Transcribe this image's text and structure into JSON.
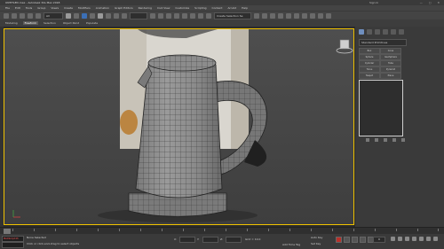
{
  "window": {
    "title": "UNTITLED.max - Autodesk 3ds Max 2018",
    "sign_in": "Sign In",
    "controls": "— ▢ ✕"
  },
  "menu": [
    "File",
    "Edit",
    "Tools",
    "Group",
    "Views",
    "Create",
    "Modifiers",
    "Animation",
    "Graph Editors",
    "Rendering",
    "Civil View",
    "Customize",
    "Scripting",
    "Content",
    "Arnold",
    "Help"
  ],
  "toolbar": {
    "selection_filter": "All",
    "named_selection": "Create Selection Se"
  },
  "ribbon_tabs": [
    {
      "label": "Modeling",
      "active": false
    },
    {
      "label": "Freeform",
      "active": true
    },
    {
      "label": "Selection",
      "active": false
    },
    {
      "label": "Object Paint",
      "active": false
    },
    {
      "label": "Populate",
      "active": false
    }
  ],
  "viewport": {
    "label": "[+] [Perspective] [Standard] [Default Shading]",
    "border_color": "#f0c200"
  },
  "command_panel": {
    "dropdown": "Standard Primitives",
    "buttons": [
      "Box",
      "Cone",
      "Sphere",
      "GeoSphere",
      "Cylinder",
      "Tube",
      "Torus",
      "Pyramid",
      "Teapot",
      "Plane"
    ]
  },
  "timeline": {
    "frame_display": "0 / 100"
  },
  "status": {
    "maxscript": "MAXScript Mi",
    "line1": "None Selected",
    "line2": "Click or click-and-drag to select objects",
    "x_label": "X:",
    "y_label": "Y:",
    "z_label": "Z:",
    "grid": "Grid = 10.0",
    "add_time_tag": "Add Time Tag",
    "auto_key": "Auto Key",
    "selected": "Selected",
    "set_key": "Set Key",
    "key_filters": "Key Filters...",
    "frame": "0"
  },
  "colors": {
    "accent_viewport": "#f0c200",
    "autokey": "#b8302a"
  }
}
